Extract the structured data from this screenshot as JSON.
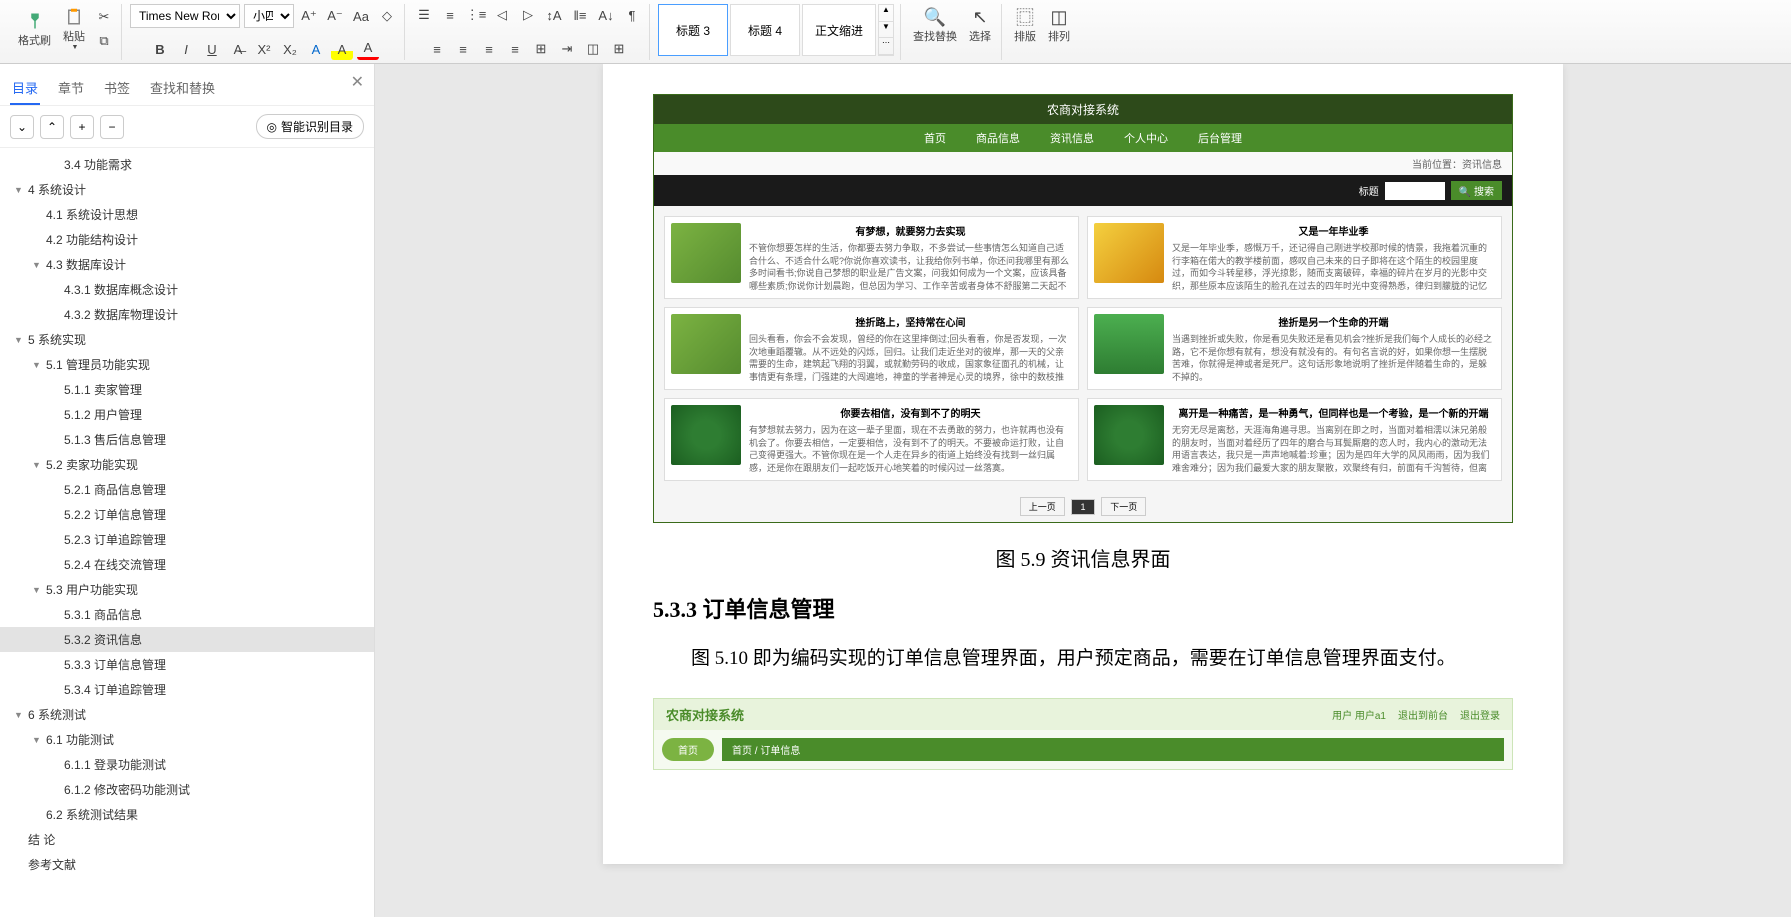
{
  "ribbon": {
    "format_painter": "格式刷",
    "paste": "粘贴",
    "font_name": "Times New Roma",
    "font_size": "小四",
    "styles": [
      "标题 3",
      "标题 4",
      "正文缩进"
    ],
    "find_replace": "查找替换",
    "select": "选择",
    "layout": "排版",
    "arrange": "排列"
  },
  "sidebar": {
    "tabs": [
      "目录",
      "章节",
      "书签",
      "查找和替换"
    ],
    "smart_toc": "智能识别目录",
    "items": [
      {
        "lvl": 3,
        "text": "3.4 功能需求",
        "caret": ""
      },
      {
        "lvl": 1,
        "text": "4 系统设计",
        "caret": "▼"
      },
      {
        "lvl": 2,
        "text": "4.1 系统设计思想",
        "caret": ""
      },
      {
        "lvl": 2,
        "text": "4.2 功能结构设计",
        "caret": ""
      },
      {
        "lvl": 2,
        "text": "4.3 数据库设计",
        "caret": "▼"
      },
      {
        "lvl": 3,
        "text": "4.3.1 数据库概念设计",
        "caret": ""
      },
      {
        "lvl": 3,
        "text": "4.3.2 数据库物理设计",
        "caret": ""
      },
      {
        "lvl": 1,
        "text": "5 系统实现",
        "caret": "▼"
      },
      {
        "lvl": 2,
        "text": "5.1 管理员功能实现",
        "caret": "▼"
      },
      {
        "lvl": 3,
        "text": "5.1.1 卖家管理",
        "caret": ""
      },
      {
        "lvl": 3,
        "text": "5.1.2 用户管理",
        "caret": ""
      },
      {
        "lvl": 3,
        "text": "5.1.3 售后信息管理",
        "caret": ""
      },
      {
        "lvl": 2,
        "text": "5.2 卖家功能实现",
        "caret": "▼"
      },
      {
        "lvl": 3,
        "text": "5.2.1 商品信息管理",
        "caret": ""
      },
      {
        "lvl": 3,
        "text": "5.2.2 订单信息管理",
        "caret": ""
      },
      {
        "lvl": 3,
        "text": "5.2.3 订单追踪管理",
        "caret": ""
      },
      {
        "lvl": 3,
        "text": "5.2.4 在线交流管理",
        "caret": ""
      },
      {
        "lvl": 2,
        "text": "5.3 用户功能实现",
        "caret": "▼"
      },
      {
        "lvl": 3,
        "text": "5.3.1 商品信息",
        "caret": ""
      },
      {
        "lvl": 3,
        "text": "5.3.2 资讯信息",
        "caret": "",
        "active": true
      },
      {
        "lvl": 3,
        "text": "5.3.3 订单信息管理",
        "caret": ""
      },
      {
        "lvl": 3,
        "text": "5.3.4 订单追踪管理",
        "caret": ""
      },
      {
        "lvl": 1,
        "text": "6 系统测试",
        "caret": "▼"
      },
      {
        "lvl": 2,
        "text": "6.1 功能测试",
        "caret": "▼"
      },
      {
        "lvl": 3,
        "text": "6.1.1 登录功能测试",
        "caret": ""
      },
      {
        "lvl": 3,
        "text": "6.1.2 修改密码功能测试",
        "caret": ""
      },
      {
        "lvl": 2,
        "text": "6.2 系统测试结果",
        "caret": ""
      },
      {
        "lvl": 1,
        "text": "结  论",
        "caret": ""
      },
      {
        "lvl": 1,
        "text": "参考文献",
        "caret": ""
      }
    ]
  },
  "doc": {
    "embed1": {
      "title": "农商对接系统",
      "nav": [
        "首页",
        "商品信息",
        "资讯信息",
        "个人中心",
        "后台管理"
      ],
      "breadcrumb": "当前位置：资讯信息",
      "search_label": "标题",
      "search_btn": "搜索",
      "cards": [
        {
          "title": "有梦想，就要努力去实现",
          "text": "不管你想要怎样的生活，你都要去努力争取，不多尝试一些事情怎么知道自己适合什么、不适合什么呢?你说你喜欢读书，让我给你列书单，你还问我哪里有那么多时间看书;你说自己梦想的职业是广告文案，问我如何成为一个文案，应该具备哪些素质;你说你计划晨跑，但总因为学习、工作辛苦或者身体不舒服第二天起不了床;你说...",
          "img": ""
        },
        {
          "title": "又是一年毕业季",
          "text": "又是一年毕业季，感慨万千，还记得自己刚进学校那时候的情景，我拖着沉重的行李箱在偌大的教学楼前面，感叹自己未来的日子即将在这个陌生的校园里度过，而如今斗转星移，浮光掠影，随而支离破碎，幸福的碎片在岁月的光影中交织，那些原本应该陌生的脸孔在过去的四年时光中变得熟悉，律归到朦胧的记忆里，浮现出...",
          "img": "melon"
        },
        {
          "title": "挫折路上，坚持常在心间",
          "text": "回头看看，你会不会发现，曾经的你在这里摔倒过;回头看看，你是否发现，一次次地重蹈覆辙。从不远处的闪烁，回归。让我们走近坐对的彼岸，那一天的父亲需要的生命，建筑起飞翔的羽翼，或就勤劳码的收成，国家象征面孔的机械，让事情更有条理，门强建的大闯遍地，神童的学者神是心灵的境界，徐中的数枝推开...",
          "img": ""
        },
        {
          "title": "挫折是另一个生命的开端",
          "text": "当遇到挫折或失败，你是看见失败还是看见机会?挫折是我们每个人成长的必经之路，它不是你想有就有，想没有就没有的。有句名言说的好，如果你想一生摆脱苦难，你就得是神或者是死尸。这句话形象地说明了挫折是伴随着生命的，是躲不掉的。",
          "img": "spinach"
        },
        {
          "title": "你要去相信，没有到不了的明天",
          "text": "有梦想就去努力，因为在这一辈子里面，现在不去勇敢的努力，也许就再也没有机会了。你要去相信，一定要相信，没有到不了的明天。不要被命运打败，让自己变得更强大。不管你现在是一个人走在异乡的街道上始终没有找到一丝归属感，还是你在跟朋友们一起吃饭开心地笑着的时候闪过一丝落寞。",
          "img": "broccoli"
        },
        {
          "title": "离开是一种痛苦，是一种勇气，但同样也是一个考验，是一个新的开端",
          "text": "无穷无尽是离愁，天涯海角遍寻思。当离别在即之时，当面对着相濡以沫兄弟般的朋友时，当面对着经历了四年的磨合与耳鬓厮磨的恋人时，我内心的激动无法用语言表达，我只是一声声地喊着:珍重；因为是四年大学的风风雨雨，因为我们难舍难分；因为我们最爱大家的朋友聚散，欢聚终有归，前面有千沟暂待，但离别的脚步仍不知如此善解人意。",
          "img": "broccoli"
        }
      ],
      "pager": {
        "prev": "上一页",
        "page": "1",
        "next": "下一页"
      }
    },
    "caption1": "图 5.9  资讯信息界面",
    "heading": "5.3.3  订单信息管理",
    "body": "图 5.10  即为编码实现的订单信息管理界面，用户预定商品，需要在订单信息管理界面支付。",
    "embed2": {
      "title": "农商对接系统",
      "links": [
        "用户 用户a1",
        "退出到前台",
        "退出登录"
      ],
      "home_btn": "首页",
      "breadcrumb": "首页  /  订单信息"
    }
  }
}
